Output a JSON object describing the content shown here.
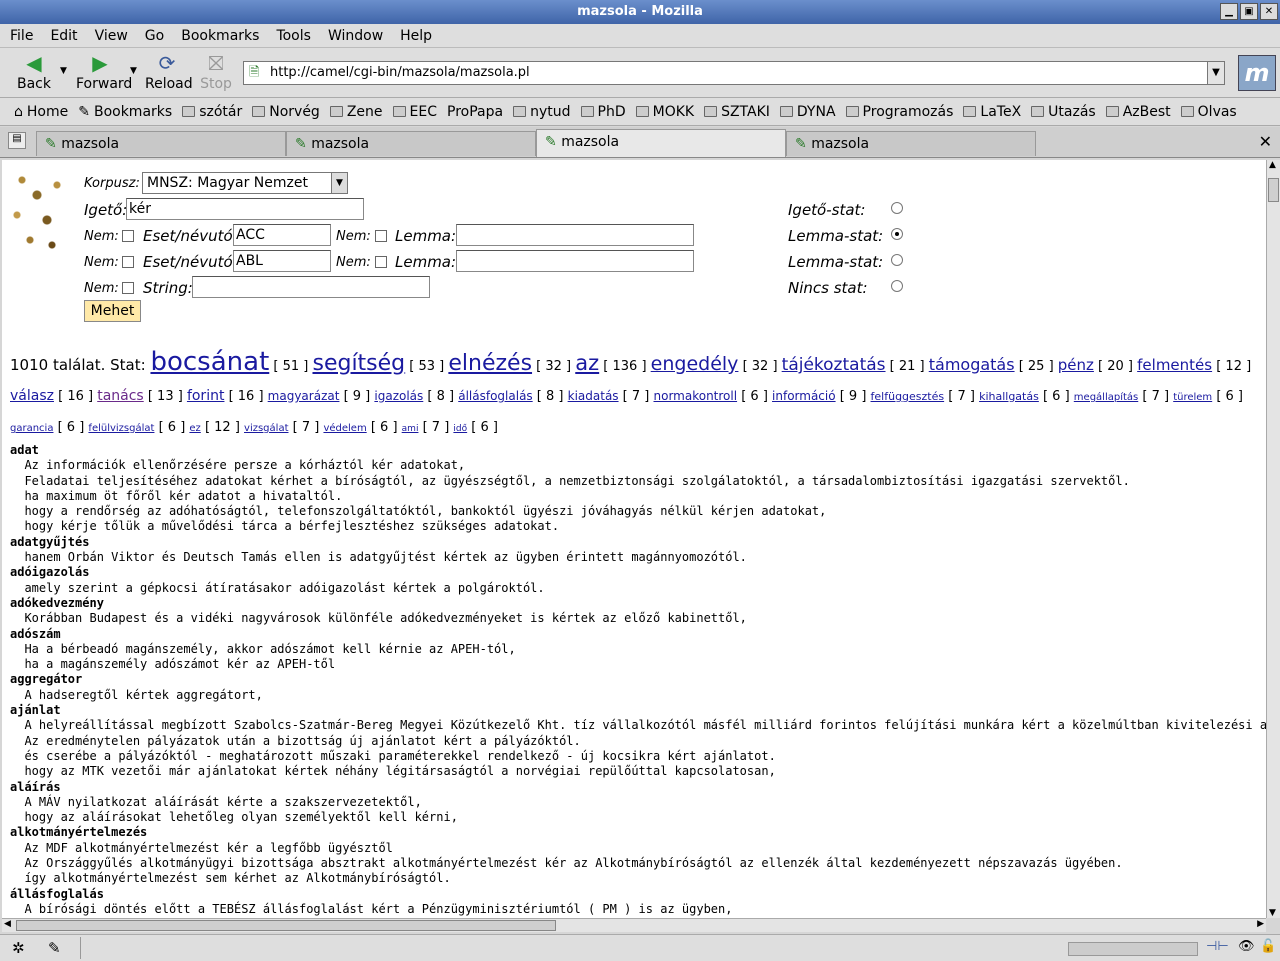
{
  "window": {
    "title": "mazsola - Mozilla"
  },
  "menu": [
    "File",
    "Edit",
    "View",
    "Go",
    "Bookmarks",
    "Tools",
    "Window",
    "Help"
  ],
  "nav": {
    "back": "Back",
    "forward": "Forward",
    "reload": "Reload",
    "stop": "Stop",
    "url": "http://camel/cgi-bin/mazsola/mazsola.pl"
  },
  "bookmarks": [
    "Home",
    "Bookmarks",
    "szótár",
    "Norvég",
    "Zene",
    "EEC",
    "ProPapa",
    "nytud",
    "PhD",
    "MOKK",
    "SZTAKI",
    "DYNA",
    "Programozás",
    "LaTeX",
    "Utazás",
    "AzBest",
    "Olvas"
  ],
  "tabs": [
    "mazsola",
    "mazsola",
    "mazsola",
    "mazsola"
  ],
  "form": {
    "korpusz_label": "Korpusz:",
    "korpusz_value": "MNSZ: Magyar Nemzet",
    "igeto_label": "Igető:",
    "igeto_value": "kér",
    "nem_label": "Nem:",
    "eset_label": "Eset/névutó:",
    "lemma_label": "Lemma:",
    "string_label": "String:",
    "eset1": "ACC",
    "eset2": "ABL",
    "submit": "Mehet",
    "radios": [
      {
        "label": "Igető-stat:",
        "checked": false
      },
      {
        "label": "Lemma-stat:",
        "checked": true
      },
      {
        "label": "Lemma-stat:",
        "checked": false
      },
      {
        "label": "Nincs stat:",
        "checked": false
      }
    ]
  },
  "stats": {
    "prefix": "1010 találat. Stat:",
    "items": [
      {
        "w": "bocsánat",
        "n": "51",
        "size": 26,
        "visited": false
      },
      {
        "w": "segítség",
        "n": "53",
        "size": 22,
        "visited": false
      },
      {
        "w": "elnézés",
        "n": "32",
        "size": 22,
        "visited": false
      },
      {
        "w": "az",
        "n": "136",
        "size": 21,
        "visited": false
      },
      {
        "w": "engedély",
        "n": "32",
        "size": 19,
        "visited": false
      },
      {
        "w": "tájékoztatás",
        "n": "21",
        "size": 17,
        "visited": false
      },
      {
        "w": "támogatás",
        "n": "25",
        "size": 16,
        "visited": false
      },
      {
        "w": "pénz",
        "n": "20",
        "size": 15,
        "visited": false
      },
      {
        "w": "felmentés",
        "n": "12",
        "size": 15,
        "visited": false
      },
      {
        "w": "válasz",
        "n": "16",
        "size": 14,
        "visited": false
      },
      {
        "w": "tanács",
        "n": "13",
        "size": 14,
        "visited": true
      },
      {
        "w": "forint",
        "n": "16",
        "size": 14,
        "visited": false
      },
      {
        "w": "magyarázat",
        "n": "9",
        "size": 12,
        "visited": false
      },
      {
        "w": "igazolás",
        "n": "8",
        "size": 12,
        "visited": false
      },
      {
        "w": "állásfoglalás",
        "n": "8",
        "size": 12,
        "visited": false
      },
      {
        "w": "kiadatás",
        "n": "7",
        "size": 12,
        "visited": false
      },
      {
        "w": "normakontroll",
        "n": "6",
        "size": 12,
        "visited": false
      },
      {
        "w": "információ",
        "n": "9",
        "size": 12,
        "visited": false
      },
      {
        "w": "felfüggesztés",
        "n": "7",
        "size": 11,
        "visited": false
      },
      {
        "w": "kihallgatás",
        "n": "6",
        "size": 11,
        "visited": false
      },
      {
        "w": "megállapítás",
        "n": "7",
        "size": 10,
        "visited": false
      },
      {
        "w": "türelem",
        "n": "6",
        "size": 10,
        "visited": false
      },
      {
        "w": "garancia",
        "n": "6",
        "size": 10,
        "visited": false
      },
      {
        "w": "felülvizsgálat",
        "n": "6",
        "size": 10,
        "visited": false
      },
      {
        "w": "ez",
        "n": "12",
        "size": 10,
        "visited": false
      },
      {
        "w": "vizsgálat",
        "n": "7",
        "size": 10,
        "visited": false
      },
      {
        "w": "védelem",
        "n": "6",
        "size": 10,
        "visited": false
      },
      {
        "w": "ami",
        "n": "7",
        "size": 9,
        "visited": false
      },
      {
        "w": "idő",
        "n": "6",
        "size": 9,
        "visited": false
      }
    ]
  },
  "results": [
    {
      "lemma": "adat",
      "lines": [
        "Az információk ellenőrzésére persze a kórháztól kér adatokat,",
        "Feladatai teljesítéséhez adatokat kérhet a bíróságtól, az ügyészségtől, a nemzetbiztonsági szolgálatoktól, a társadalombiztosítási igazgatási szervektől.",
        "ha maximum öt főről kér adatot a hivataltól.",
        "hogy a rendőrség az adóhatóságtól, telefonszolgáltatóktól, bankoktól ügyészi jóváhagyás nélkül kérjen adatokat,",
        "hogy kérje tőlük a művelődési tárca a bérfejlesztéshez szükséges adatokat."
      ]
    },
    {
      "lemma": "adatgyűjtés",
      "lines": [
        "hanem Orbán Viktor és Deutsch Tamás ellen is adatgyűjtést kértek az ügyben érintett magánnyomozótól."
      ]
    },
    {
      "lemma": "adóigazolás",
      "lines": [
        "amely szerint a gépkocsi átíratásakor adóigazolást kértek a polgároktól."
      ]
    },
    {
      "lemma": "adókedvezmény",
      "lines": [
        "Korábban Budapest és a vidéki nagyvárosok különféle adókedvezményeket is kértek az előző kabinettől,"
      ]
    },
    {
      "lemma": "adószám",
      "lines": [
        "Ha a bérbeadó magánszemély, akkor adószámot kell kérnie az APEH-tól,",
        "ha a magánszemély adószámot kér az APEH-től"
      ]
    },
    {
      "lemma": "aggregátor",
      "lines": [
        "A hadseregtől kértek aggregátort,"
      ]
    },
    {
      "lemma": "ajánlat",
      "lines": [
        "A helyreállítással megbízott Szabolcs-Szatmár-Bereg Megyei Közútkezelő Kht. tíz vállalkozótól másfél milliárd forintos felújítási munkára kért a közelmúltban kivitelezési ajánlatot,",
        "Az eredménytelen pályázatok után a bizottság új ajánlatot kért a pályázóktól.",
        "és cserébe a pályázóktól - meghatározott műszaki paraméterekkel rendelkező - új kocsikra kért ajánlatot.",
        "hogy az MTK vezetői már ajánlatokat kértek néhány légitársaságtól a norvégiai repülőúttal kapcsolatosan,"
      ]
    },
    {
      "lemma": "aláírás",
      "lines": [
        "A MÁV nyilatkozat aláírását kérte a szakszervezetektől,",
        "hogy az aláírásokat lehetőleg olyan személyektől kell kérni,"
      ]
    },
    {
      "lemma": "alkotmányértelmezés",
      "lines": [
        "Az MDF alkotmányértelmezést kér a legfőbb ügyésztől",
        "Az Országgyűlés alkotmányügyi bizottsága absztrakt alkotmányértelmezést kér az Alkotmánybíróságtól az ellenzék által kezdeményezett népszavazás ügyében.",
        "így alkotmányértelmezést sem kérhet az Alkotmánybíróságtól."
      ]
    },
    {
      "lemma": "állásfoglalás",
      "lines": [
        "A bírósági döntés előtt a TEBÉSZ állásfoglalást kért a Pénzügyminisztériumtól ( PM ) is az ügyben,"
      ]
    }
  ]
}
